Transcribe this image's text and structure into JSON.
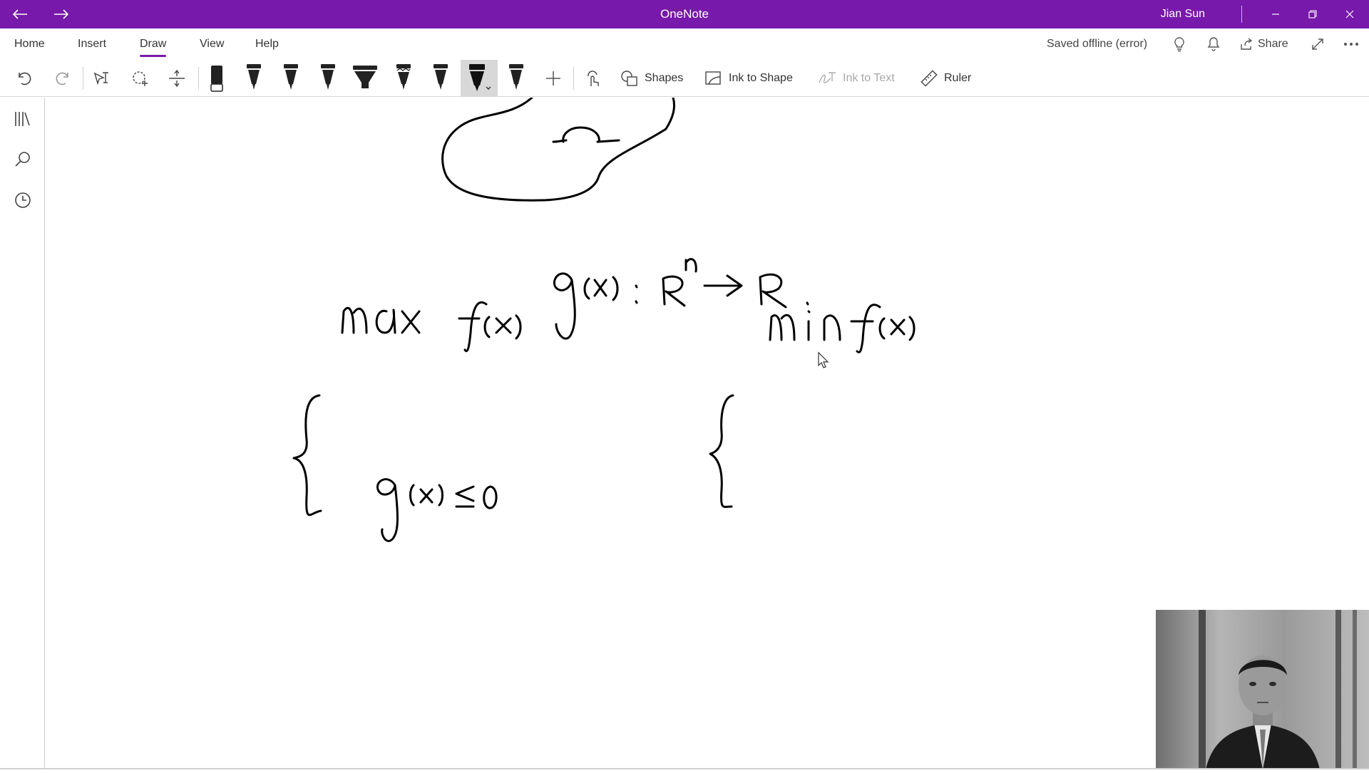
{
  "app": {
    "title": "OneNote",
    "user": "Jian Sun",
    "accent": "#7719aa"
  },
  "ribbon": {
    "tabs": [
      {
        "label": "Home",
        "active": false
      },
      {
        "label": "Insert",
        "active": false
      },
      {
        "label": "Draw",
        "active": true
      },
      {
        "label": "View",
        "active": false
      },
      {
        "label": "Help",
        "active": false
      }
    ],
    "status": "Saved offline (error)",
    "share_label": "Share"
  },
  "toolbar": {
    "shapes_label": "Shapes",
    "ink_to_shape_label": "Ink to Shape",
    "ink_to_text_label": "Ink to Text",
    "ruler_label": "Ruler",
    "ink_color": "#000000"
  },
  "sidebar": {
    "icons": [
      "notebooks-icon",
      "search-icon",
      "recent-icon"
    ]
  }
}
